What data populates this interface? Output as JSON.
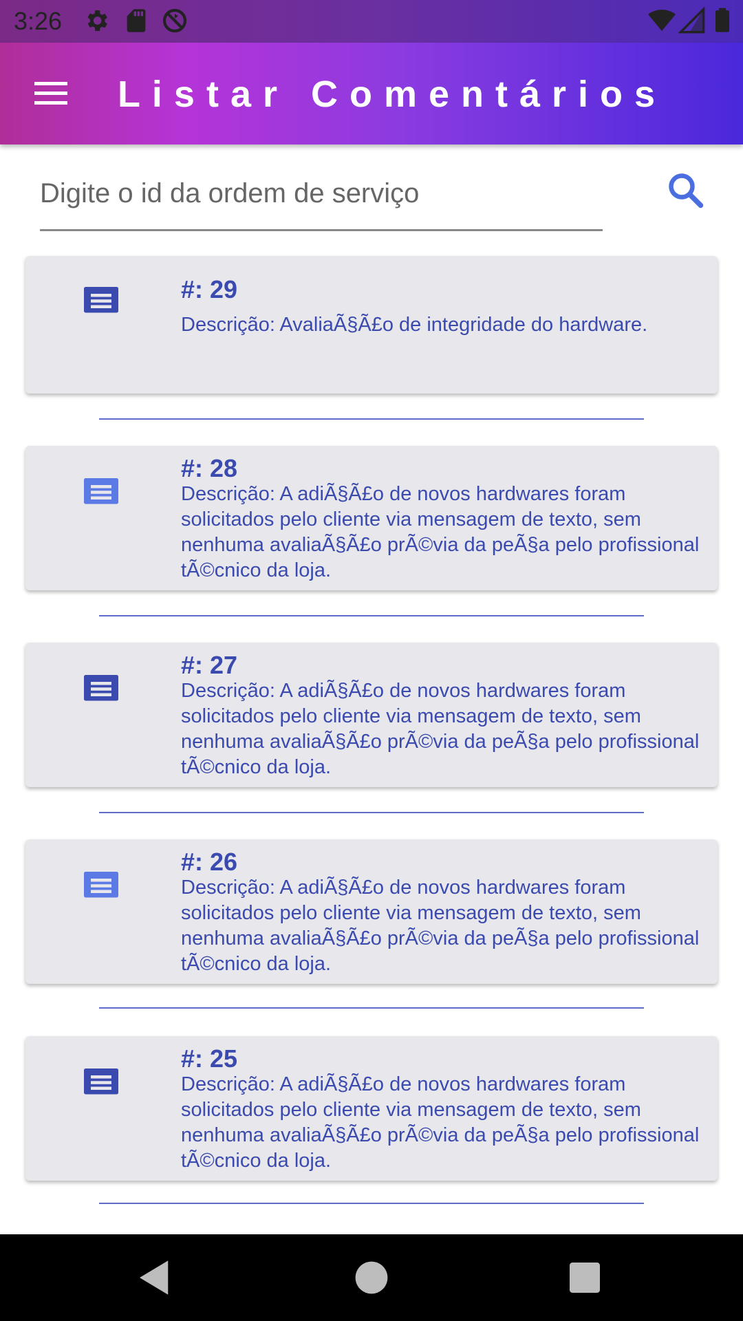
{
  "status_bar": {
    "time": "3:26",
    "left_icons": [
      "gear-icon",
      "sd-card-icon",
      "sync-off-icon"
    ],
    "right_icons": [
      "wifi-icon",
      "signal-icon",
      "battery-icon"
    ]
  },
  "app_bar": {
    "title": "Listar Comentários",
    "menu_icon": "hamburger-menu-icon"
  },
  "search": {
    "placeholder": "Digite o id da ordem de serviço",
    "value": "",
    "icon": "search-icon"
  },
  "colors": {
    "accent": "#3b4aae",
    "icon_dark": "#3b4aae",
    "icon_light": "#5b7ae6",
    "card_bg": "#e8e8ec",
    "search_icon": "#4a6ee0"
  },
  "comments": [
    {
      "id_label": "#: 29",
      "description": "Descrição: AvaliaÃ§Ã£o de integridade do hardware."
    },
    {
      "id_label": "#: 28",
      "description": "Descrição: A adiÃ§Ã£o de novos hardwares foram solicitados pelo cliente via mensagem de texto, sem nenhuma avaliaÃ§Ã£o prÃ©via da peÃ§a pelo profissional tÃ©cnico da loja."
    },
    {
      "id_label": "#: 27",
      "description": "Descrição: A adiÃ§Ã£o de novos hardwares foram solicitados pelo cliente via mensagem de texto, sem nenhuma avaliaÃ§Ã£o prÃ©via da peÃ§a pelo profissional tÃ©cnico da loja."
    },
    {
      "id_label": "#: 26",
      "description": "Descrição: A adiÃ§Ã£o de novos hardwares foram solicitados pelo cliente via mensagem de texto, sem nenhuma avaliaÃ§Ã£o prÃ©via da peÃ§a pelo profissional tÃ©cnico da loja."
    },
    {
      "id_label": "#: 25",
      "description": "Descrição: A adiÃ§Ã£o de novos hardwares foram solicitados pelo cliente via mensagem de texto, sem nenhuma avaliaÃ§Ã£o prÃ©via da peÃ§a pelo profissional tÃ©cnico da loja."
    }
  ],
  "nav_bar": {
    "buttons": [
      "back-icon",
      "home-icon",
      "recents-icon"
    ]
  }
}
